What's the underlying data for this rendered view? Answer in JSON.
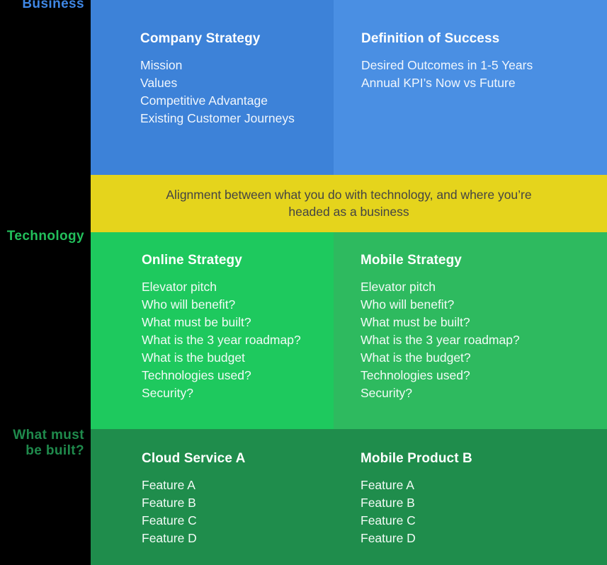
{
  "axis_labels": [
    {
      "id": "business",
      "text": "Business",
      "color": "#3f87e5"
    },
    {
      "id": "technology",
      "text": "Technology",
      "color": "#22bf5b"
    },
    {
      "id": "built",
      "text": "What must\nbe built?",
      "color": "#1f8a4c"
    }
  ],
  "alignment_band": {
    "text": "Alignment between what you do with technology, and where you’re headed as a business",
    "background": "#e5d41c",
    "text_color": "#444444"
  },
  "panels": {
    "company_strategy": {
      "title": "Company Strategy",
      "items": [
        "Mission",
        "Values",
        "Competitive Advantage",
        "Existing Customer Journeys"
      ],
      "background": "#3d82d8"
    },
    "definition_of_success": {
      "title": "Definition of Success",
      "items": [
        "Desired Outcomes in 1-5 Years",
        "Annual KPI’s Now vs Future"
      ],
      "background": "#4a8fe3"
    },
    "online_strategy": {
      "title": "Online Strategy",
      "items": [
        "Elevator pitch",
        "Who will benefit?",
        "What must be built?",
        "What is the 3 year roadmap?",
        "What is the budget",
        "Technologies used?",
        "Security?"
      ],
      "background": "#1ec95e"
    },
    "mobile_strategy": {
      "title": "Mobile Strategy",
      "items": [
        "Elevator pitch",
        "Who will benefit?",
        "What must be built?",
        "What is the 3 year roadmap?",
        "What is the budget?",
        "Technologies used?",
        "Security?"
      ],
      "background": "#2eba5f"
    },
    "cloud_service_a": {
      "title": "Cloud Service A",
      "items": [
        "Feature A",
        "Feature B",
        "Feature C",
        "Feature D"
      ],
      "background": "#1f8d4c"
    },
    "mobile_product_b": {
      "title": "Mobile Product B",
      "items": [
        "Feature A",
        "Feature B",
        "Feature C",
        "Feature D"
      ],
      "background": "#1f8d4c"
    }
  }
}
